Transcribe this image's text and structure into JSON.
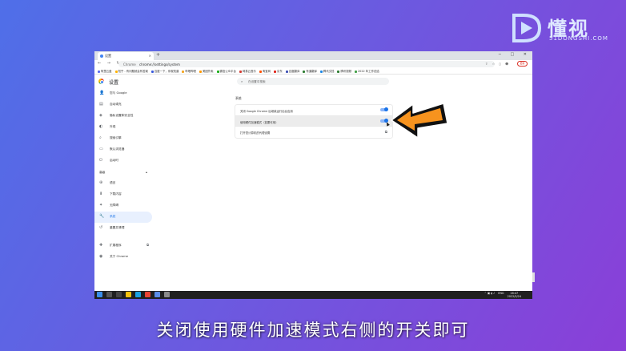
{
  "logo": {
    "brand": "懂视",
    "sub": "51DONGSHI.COM"
  },
  "browser": {
    "tab_title": "设置",
    "tab_close": "×",
    "new_tab": "+",
    "window_controls": "─ □ ✕",
    "nav": "← → ↻",
    "address_site": "Chrome",
    "address_url": "chrome://settings/system",
    "toolbar_icons": "⇪ ☆ ▯ ☻",
    "update_label": "更新",
    "bookmarks": [
      {
        "label": "阿里云盘",
        "color": "#5a6cf0"
      },
      {
        "label": "知乎 - 有问题就会有答案",
        "color": "#ffb300"
      },
      {
        "label": "百度一下，你就知道",
        "color": "#3b5bdb"
      },
      {
        "label": "哔哩哔哩",
        "color": "#f5a623"
      },
      {
        "label": "美团外卖",
        "color": "#ff9800"
      },
      {
        "label": "微信公众平台",
        "color": "#1aad19"
      },
      {
        "label": "网易云音乐",
        "color": "#d33a31"
      },
      {
        "label": "淘宝网",
        "color": "#ff5000"
      },
      {
        "label": "京东",
        "color": "#e1251b"
      },
      {
        "label": "百度翻译",
        "color": "#3f51b5"
      },
      {
        "label": "有道翻译",
        "color": "#2e7d32"
      },
      {
        "label": "腾讯文档",
        "color": "#1e88e5"
      },
      {
        "label": "腾讯视频",
        "color": "#2e7d32"
      },
      {
        "label": "2022 年工作总结",
        "color": "#43a047"
      }
    ]
  },
  "settings": {
    "title": "设置",
    "search_placeholder": "在设置中搜索",
    "sidebar": [
      {
        "label": "您与 Google",
        "icon": "person-icon",
        "glyph": "👤"
      },
      {
        "label": "自动填充",
        "icon": "autofill-icon",
        "glyph": "▤"
      },
      {
        "label": "隐私设置和安全性",
        "icon": "shield-icon",
        "glyph": "◈"
      },
      {
        "label": "外观",
        "icon": "palette-icon",
        "glyph": "◐"
      },
      {
        "label": "搜索引擎",
        "icon": "search-icon",
        "glyph": "⌕"
      },
      {
        "label": "默认浏览器",
        "icon": "browser-icon",
        "glyph": "▭"
      },
      {
        "label": "启动时",
        "icon": "power-icon",
        "glyph": "⏻"
      }
    ],
    "advanced_group": {
      "label": "高级",
      "caret": "▴"
    },
    "advanced_items": [
      {
        "label": "语言",
        "icon": "globe-icon",
        "glyph": "⊕",
        "active": false
      },
      {
        "label": "下载内容",
        "icon": "download-icon",
        "glyph": "⬇",
        "active": false
      },
      {
        "label": "无障碍",
        "icon": "accessibility-icon",
        "glyph": "✦",
        "active": false
      },
      {
        "label": "系统",
        "icon": "wrench-icon",
        "glyph": "🔧",
        "active": true
      },
      {
        "label": "重置并清理",
        "icon": "reset-icon",
        "glyph": "↺",
        "active": false
      }
    ],
    "footer_items": [
      {
        "label": "扩展程序",
        "icon": "puzzle-icon",
        "glyph": "✚",
        "ext": "⧉"
      },
      {
        "label": "关于 Chrome",
        "icon": "chrome-icon",
        "glyph": "◉",
        "ext": ""
      }
    ],
    "section_title": "系统",
    "rows": [
      {
        "label": "关闭 Google Chrome 后继续运行后台应用",
        "control": "toggle",
        "checked": true
      },
      {
        "label": "使用硬件加速模式（如果可用）",
        "control": "toggle",
        "checked": true
      },
      {
        "label": "打开您计算机的代理设置",
        "control": "open",
        "glyph": "⧉"
      }
    ]
  },
  "taskbar": {
    "icons": [
      {
        "name": "start-icon",
        "color": "#3b8eea"
      },
      {
        "name": "search-icon",
        "color": "#555555"
      },
      {
        "name": "taskview-icon",
        "color": "#444444"
      },
      {
        "name": "explorer-icon",
        "color": "#f4c20d"
      },
      {
        "name": "edge-icon",
        "color": "#1aa1e2"
      },
      {
        "name": "chrome-icon",
        "color": "#ea4335"
      },
      {
        "name": "photos-icon",
        "color": "#5c8de8"
      },
      {
        "name": "settings-icon",
        "color": "#8a8a8a"
      }
    ],
    "tray_symbols": "⌃ ▣ ◖ ♪",
    "lang": "ENG",
    "time": "16:47",
    "date": "2022/5/24"
  },
  "subtitle": "关闭使用硬件加速模式右侧的开关即可"
}
